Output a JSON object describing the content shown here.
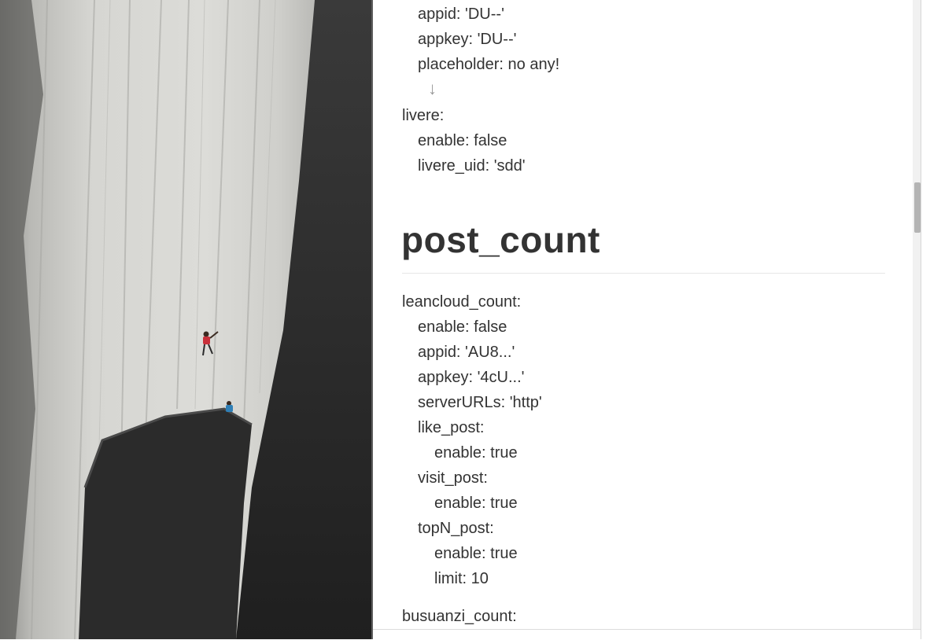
{
  "photo": {
    "description_icon": "climber-photo"
  },
  "document": {
    "lines_top": [
      {
        "text": "appid: 'DU--'",
        "indent": 1
      },
      {
        "text": "appkey: 'DU--'",
        "indent": 1
      },
      {
        "text": "placeholder: no any!",
        "indent": 1
      }
    ],
    "arrow": "↓",
    "livere": [
      {
        "text": "livere:",
        "indent": 0
      },
      {
        "text": "enable: false",
        "indent": 1
      },
      {
        "text": "livere_uid: 'sdd'",
        "indent": 1
      }
    ],
    "heading": "post_count",
    "post_count_lines": [
      {
        "text": "leancloud_count:",
        "indent": 0
      },
      {
        "text": "enable: false",
        "indent": 1
      },
      {
        "text": "appid: 'AU8...'",
        "indent": 1
      },
      {
        "text": "appkey: '4cU...'",
        "indent": 1
      },
      {
        "text": "serverURLs: 'http'",
        "indent": 1
      },
      {
        "text": "like_post:",
        "indent": 1
      },
      {
        "text": "enable: true",
        "indent": 2
      },
      {
        "text": "visit_post:",
        "indent": 1
      },
      {
        "text": "enable: true",
        "indent": 2
      },
      {
        "text": "topN_post:",
        "indent": 1
      },
      {
        "text": "enable: true",
        "indent": 2
      },
      {
        "text": "limit: 10",
        "indent": 2
      }
    ],
    "busuanzi": "busuanzi_count:"
  },
  "colors": {
    "text": "#333333",
    "rock_light": "#cfcfcc",
    "rock_dark": "#2e2e2e",
    "climber_red": "#c8303a",
    "climber_blue": "#2f7fb6"
  }
}
